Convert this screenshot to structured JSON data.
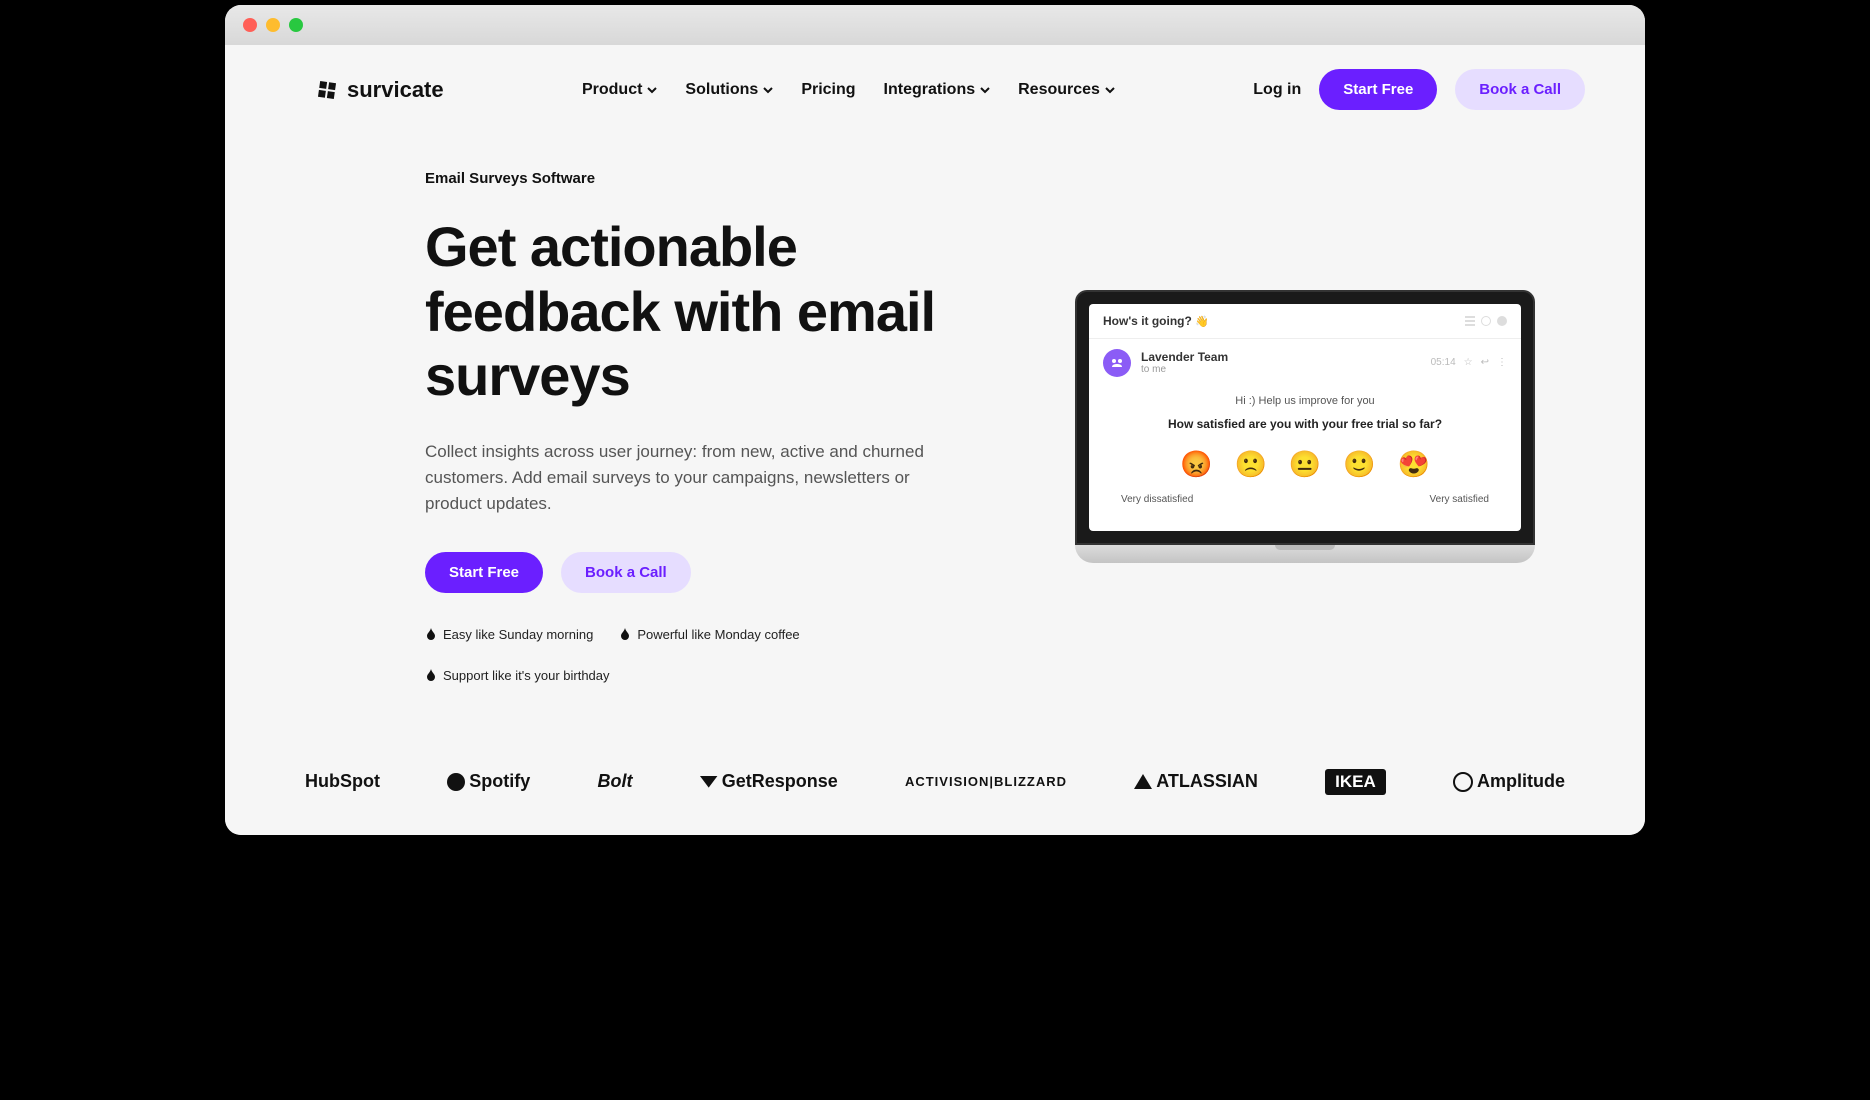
{
  "brand": "survicate",
  "nav": {
    "items": [
      {
        "label": "Product",
        "dropdown": true
      },
      {
        "label": "Solutions",
        "dropdown": true
      },
      {
        "label": "Pricing",
        "dropdown": false
      },
      {
        "label": "Integrations",
        "dropdown": true
      },
      {
        "label": "Resources",
        "dropdown": true
      }
    ],
    "login": "Log in",
    "cta_primary": "Start Free",
    "cta_secondary": "Book a Call"
  },
  "hero": {
    "eyebrow": "Email Surveys Software",
    "headline": "Get actionable feedback with email surveys",
    "subhead": "Collect insights across user journey: from new, active and churned customers. Add email surveys to your campaigns, newsletters or product updates.",
    "cta_primary": "Start Free",
    "cta_secondary": "Book a Call",
    "perks": [
      "Easy like Sunday morning",
      "Powerful like Monday coffee",
      "Support like it's your birthday"
    ]
  },
  "mock": {
    "subject": "How's it going?",
    "sender": "Lavender Team",
    "recipient": "to me",
    "time": "05:14",
    "greeting": "Hi :) Help us improve for you",
    "question": "How satisfied are you with your free trial so far?",
    "emojis": [
      "😡",
      "🙁",
      "😐",
      "🙂",
      "😍"
    ],
    "label_low": "Very dissatisfied",
    "label_high": "Very satisfied"
  },
  "clients": [
    "HubSpot",
    "Spotify",
    "Bolt",
    "GetResponse",
    "ACTIVISION|BLIZZARD",
    "ATLASSIAN",
    "IKEA",
    "Amplitude"
  ],
  "colors": {
    "primary": "#6b1fff",
    "secondary_bg": "#e6ddff"
  }
}
